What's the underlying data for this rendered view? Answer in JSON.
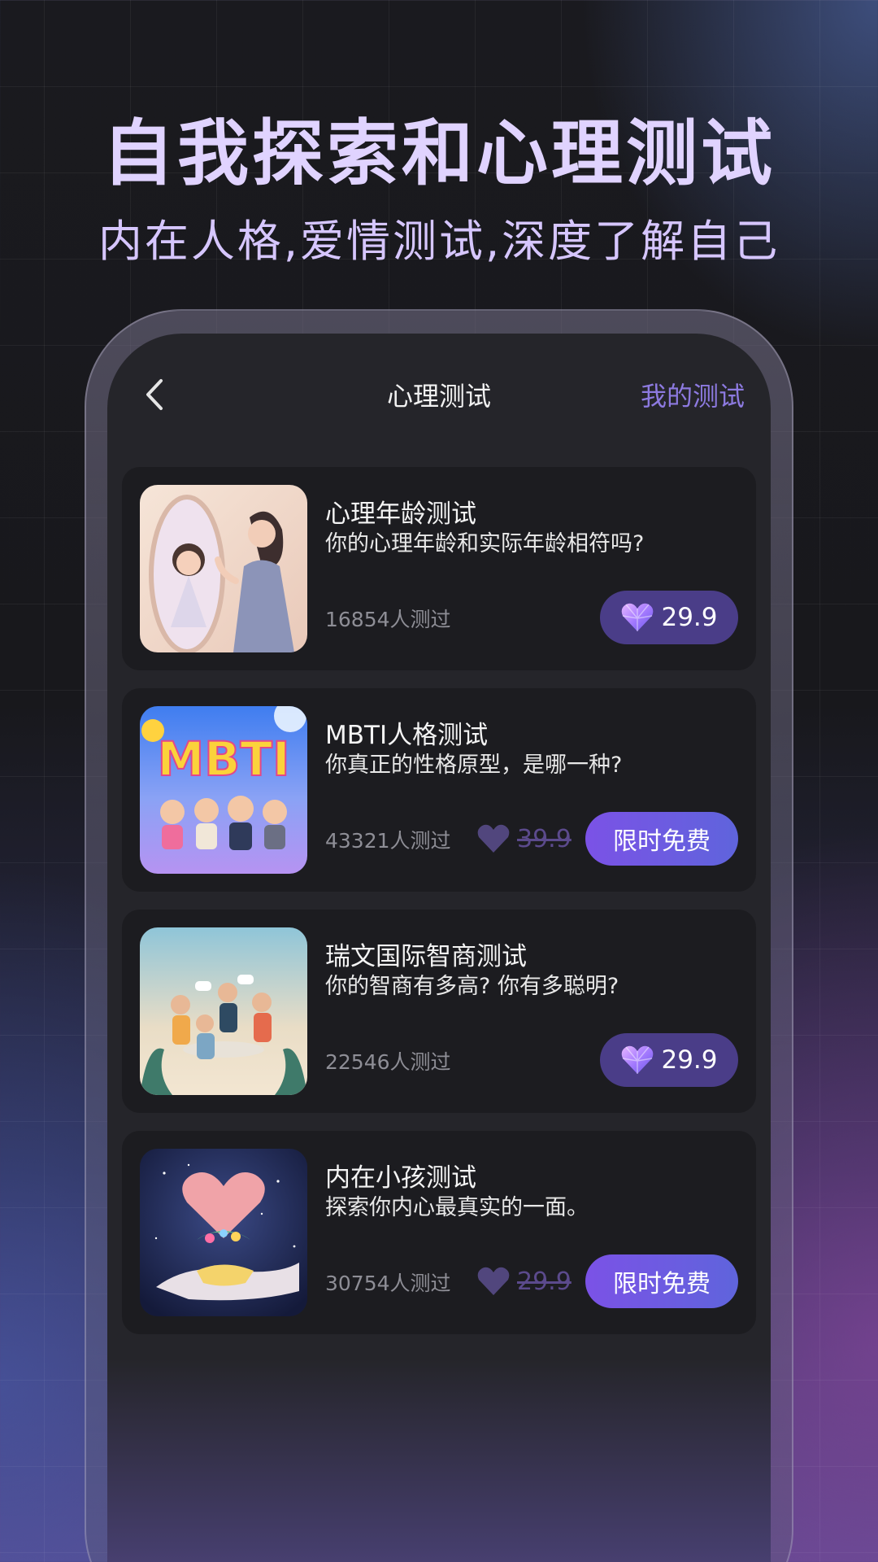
{
  "hero": {
    "title": "自我探索和心理测试",
    "subtitle": "内在人格,爱情测试,深度了解自己"
  },
  "nav": {
    "back_icon": "chevron-left-icon",
    "title": "心理测试",
    "right_link": "我的测试"
  },
  "colors": {
    "accent": "#8d7ae0",
    "price_button": "#4a3d88",
    "free_button_start": "#7b52e6",
    "free_button_end": "#5f64dc",
    "card_bg": "#1c1c20",
    "screen_bg": "#25252a"
  },
  "tests": [
    {
      "title": "心理年龄测试",
      "desc": "你的心理年龄和实际年龄相符吗?",
      "count": "16854人测过",
      "price": "29.9",
      "free": false,
      "icon": "heart-gem-icon"
    },
    {
      "title": "MBTI人格测试",
      "desc": "你真正的性格原型，是哪一种?",
      "count": "43321人测过",
      "old_price": "39.9",
      "free_label": "限时免费",
      "free": true,
      "thumb_text": "MBTI",
      "icon": "heart-gem-icon"
    },
    {
      "title": "瑞文国际智商测试",
      "desc": "你的智商有多高? 你有多聪明?",
      "count": "22546人测过",
      "price": "29.9",
      "free": false,
      "icon": "heart-gem-icon"
    },
    {
      "title": "内在小孩测试",
      "desc": "探索你内心最真实的一面。",
      "count": "30754人测过",
      "old_price": "29.9",
      "free_label": "限时免费",
      "free": true,
      "icon": "heart-gem-icon"
    }
  ]
}
